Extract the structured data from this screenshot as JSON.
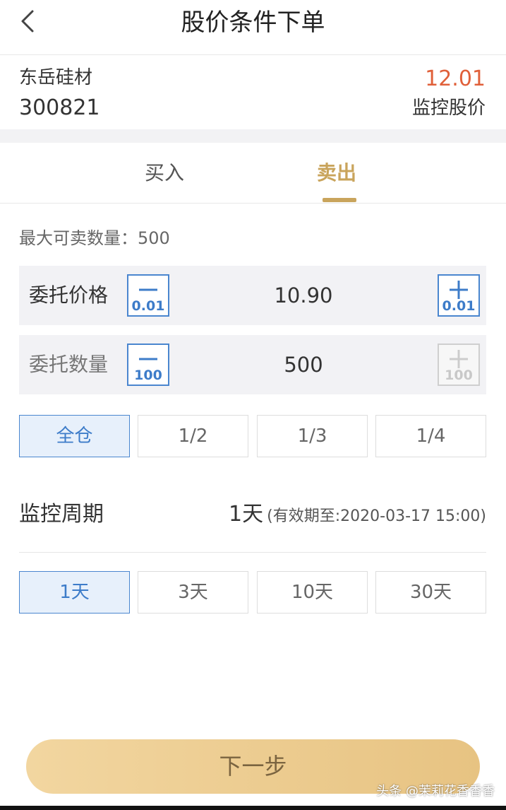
{
  "header": {
    "title": "股价条件下单"
  },
  "stock": {
    "name": "东岳硅材",
    "code": "300821",
    "monitor_price": "12.01",
    "monitor_label": "监控股价"
  },
  "tabs": {
    "buy": "买入",
    "sell": "卖出",
    "active": "sell"
  },
  "max_qty": "最大可卖数量：500",
  "price_row": {
    "label": "委托价格",
    "value": "10.90",
    "minus_step": "0.01",
    "plus_step": "0.01"
  },
  "qty_row": {
    "label": "委托数量",
    "value": "500",
    "minus_step": "100",
    "plus_step": "100",
    "plus_disabled": true
  },
  "ratio_options": [
    "全仓",
    "1/2",
    "1/3",
    "1/4"
  ],
  "ratio_selected": "全仓",
  "period": {
    "label": "监控周期",
    "days": "1天",
    "expiry": "(有效期至:2020-03-17 15:00)"
  },
  "period_options": [
    "1天",
    "3天",
    "10天",
    "30天"
  ],
  "period_selected": "1天",
  "next_button": "下一步",
  "watermark": "头条 @茉莉花香香香",
  "colors": {
    "accent_gold": "#c9a45c",
    "price_red": "#e0603a",
    "blue": "#3d7cc9",
    "selected_bg": "#e7f0fb"
  }
}
